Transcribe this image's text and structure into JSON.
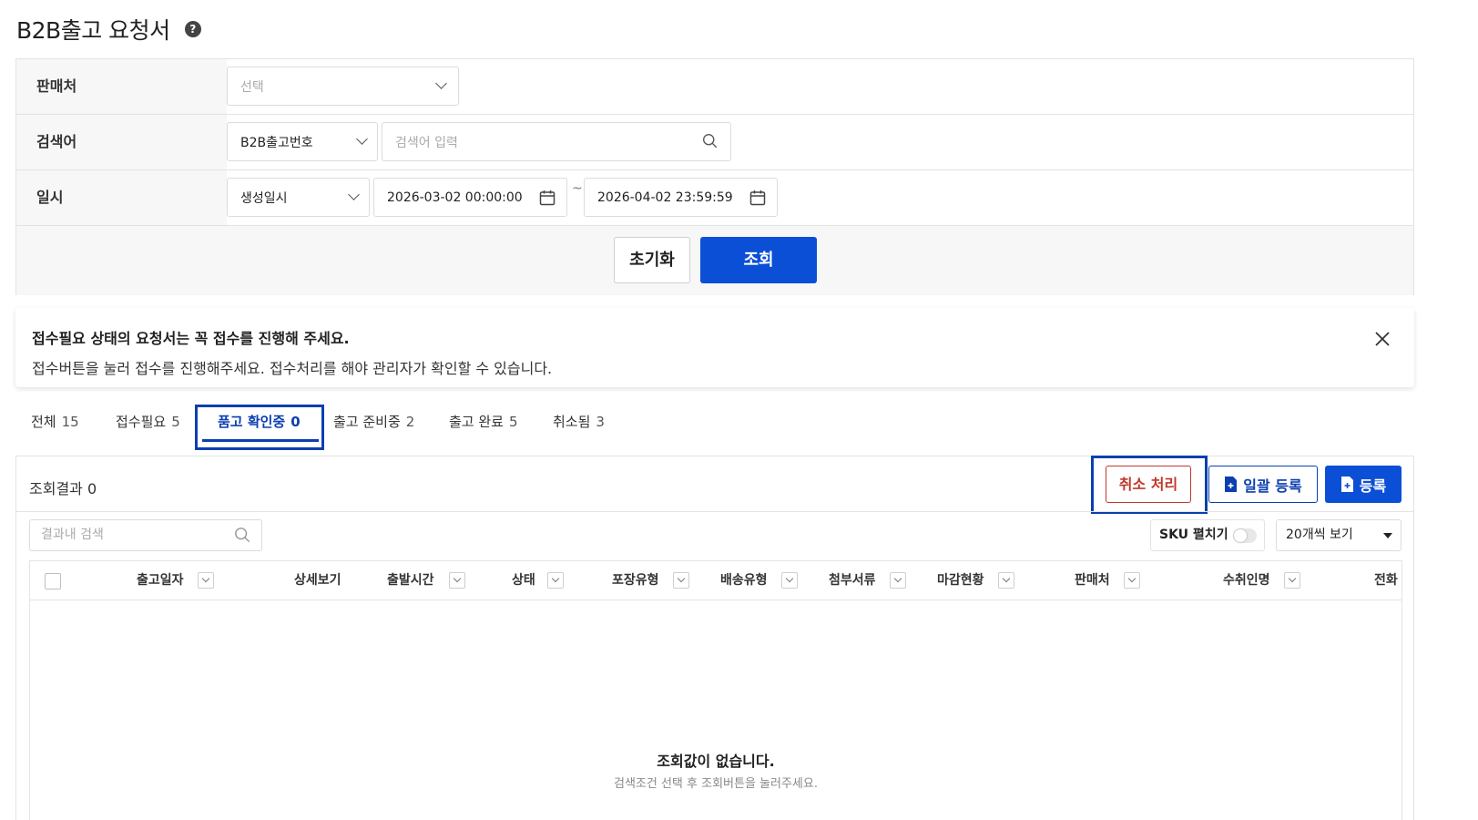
{
  "page": {
    "title": "B2B출고 요청서",
    "help_icon": "?"
  },
  "filters": {
    "seller": {
      "label": "판매처",
      "placeholder": "선택"
    },
    "keyword": {
      "label": "검색어",
      "type_value": "B2B출고번호",
      "placeholder": "검색어 입력"
    },
    "datetime": {
      "label": "일시",
      "type_value": "생성일시",
      "from": "2026-03-02 00:00:00",
      "separator": "~",
      "to": "2026-04-02 23:59:59"
    },
    "reset_label": "초기화",
    "search_label": "조회"
  },
  "notice": {
    "title": "접수필요 상태의 요청서는 꼭 접수를 진행해 주세요.",
    "body": "접수버튼을 눌러 접수를 진행해주세요. 접수처리를 해야 관리자가 확인할 수 있습니다."
  },
  "tabs": [
    {
      "label": "전체",
      "count": "15"
    },
    {
      "label": "접수필요",
      "count": "5"
    },
    {
      "label": "품고 확인중",
      "count": "0"
    },
    {
      "label": "출고 준비중",
      "count": "2"
    },
    {
      "label": "출고 완료",
      "count": "5"
    },
    {
      "label": "취소됨",
      "count": "3"
    }
  ],
  "results": {
    "count_label": "조회결과 0",
    "cancel_label": "취소 처리",
    "bulk_label": "일괄 등록",
    "register_label": "등록",
    "inner_search_placeholder": "결과내 검색",
    "sku_label": "SKU 펼치기",
    "page_size": "20개씩 보기",
    "columns": [
      "출고일자",
      "상세보기",
      "출발시간",
      "상태",
      "포장유형",
      "배송유형",
      "첨부서류",
      "마감현황",
      "판매처",
      "수취인명",
      "전화"
    ],
    "empty_title": "조회값이 없습니다.",
    "empty_sub": "검색조건 선택 후 조회버튼을 눌러주세요."
  },
  "colors": {
    "primary": "#0b4fd6",
    "highlight": "#0b3fb0",
    "danger": "#c0392b"
  }
}
